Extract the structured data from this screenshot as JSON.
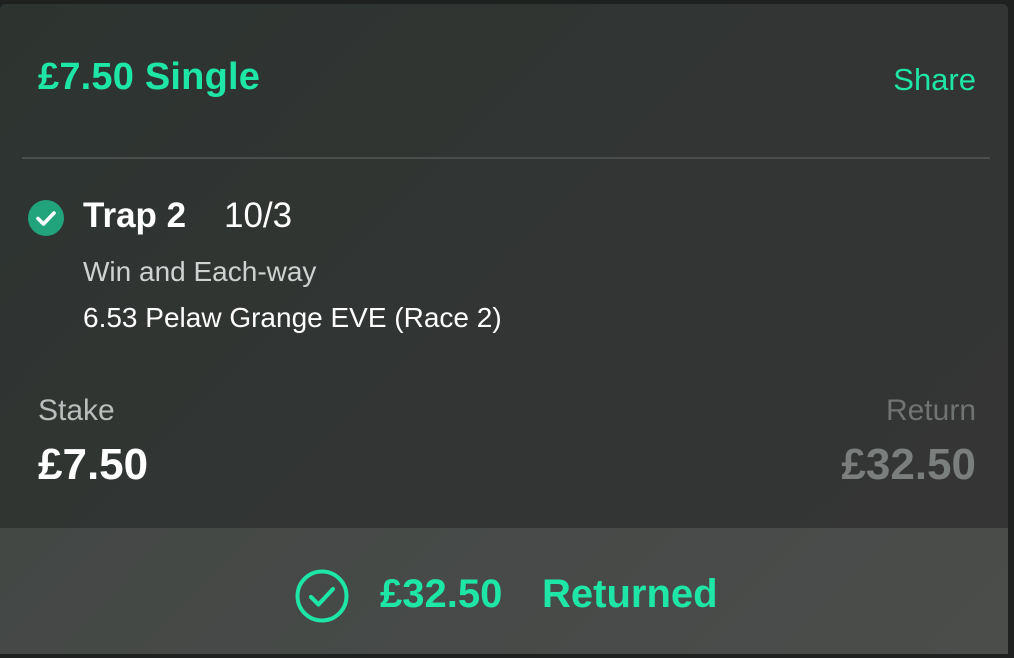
{
  "bet": {
    "title": "£7.50 Single",
    "share_label": "Share"
  },
  "selection": {
    "name": "Trap 2",
    "odds": "10/3",
    "market": "Win and Each-way",
    "event": "6.53 Pelaw Grange EVE (Race 2)",
    "status_icon": "check-circle-icon"
  },
  "stake": {
    "label": "Stake",
    "value": "£7.50"
  },
  "return": {
    "label": "Return",
    "value": "£32.50"
  },
  "footer": {
    "amount": "£32.50",
    "status": "Returned",
    "icon": "check-circle-outline-icon"
  },
  "colors": {
    "accent": "#1ee6a6",
    "check_fill": "#21a37c",
    "card_bg": "#313533",
    "footer_bg": "#474a48"
  }
}
